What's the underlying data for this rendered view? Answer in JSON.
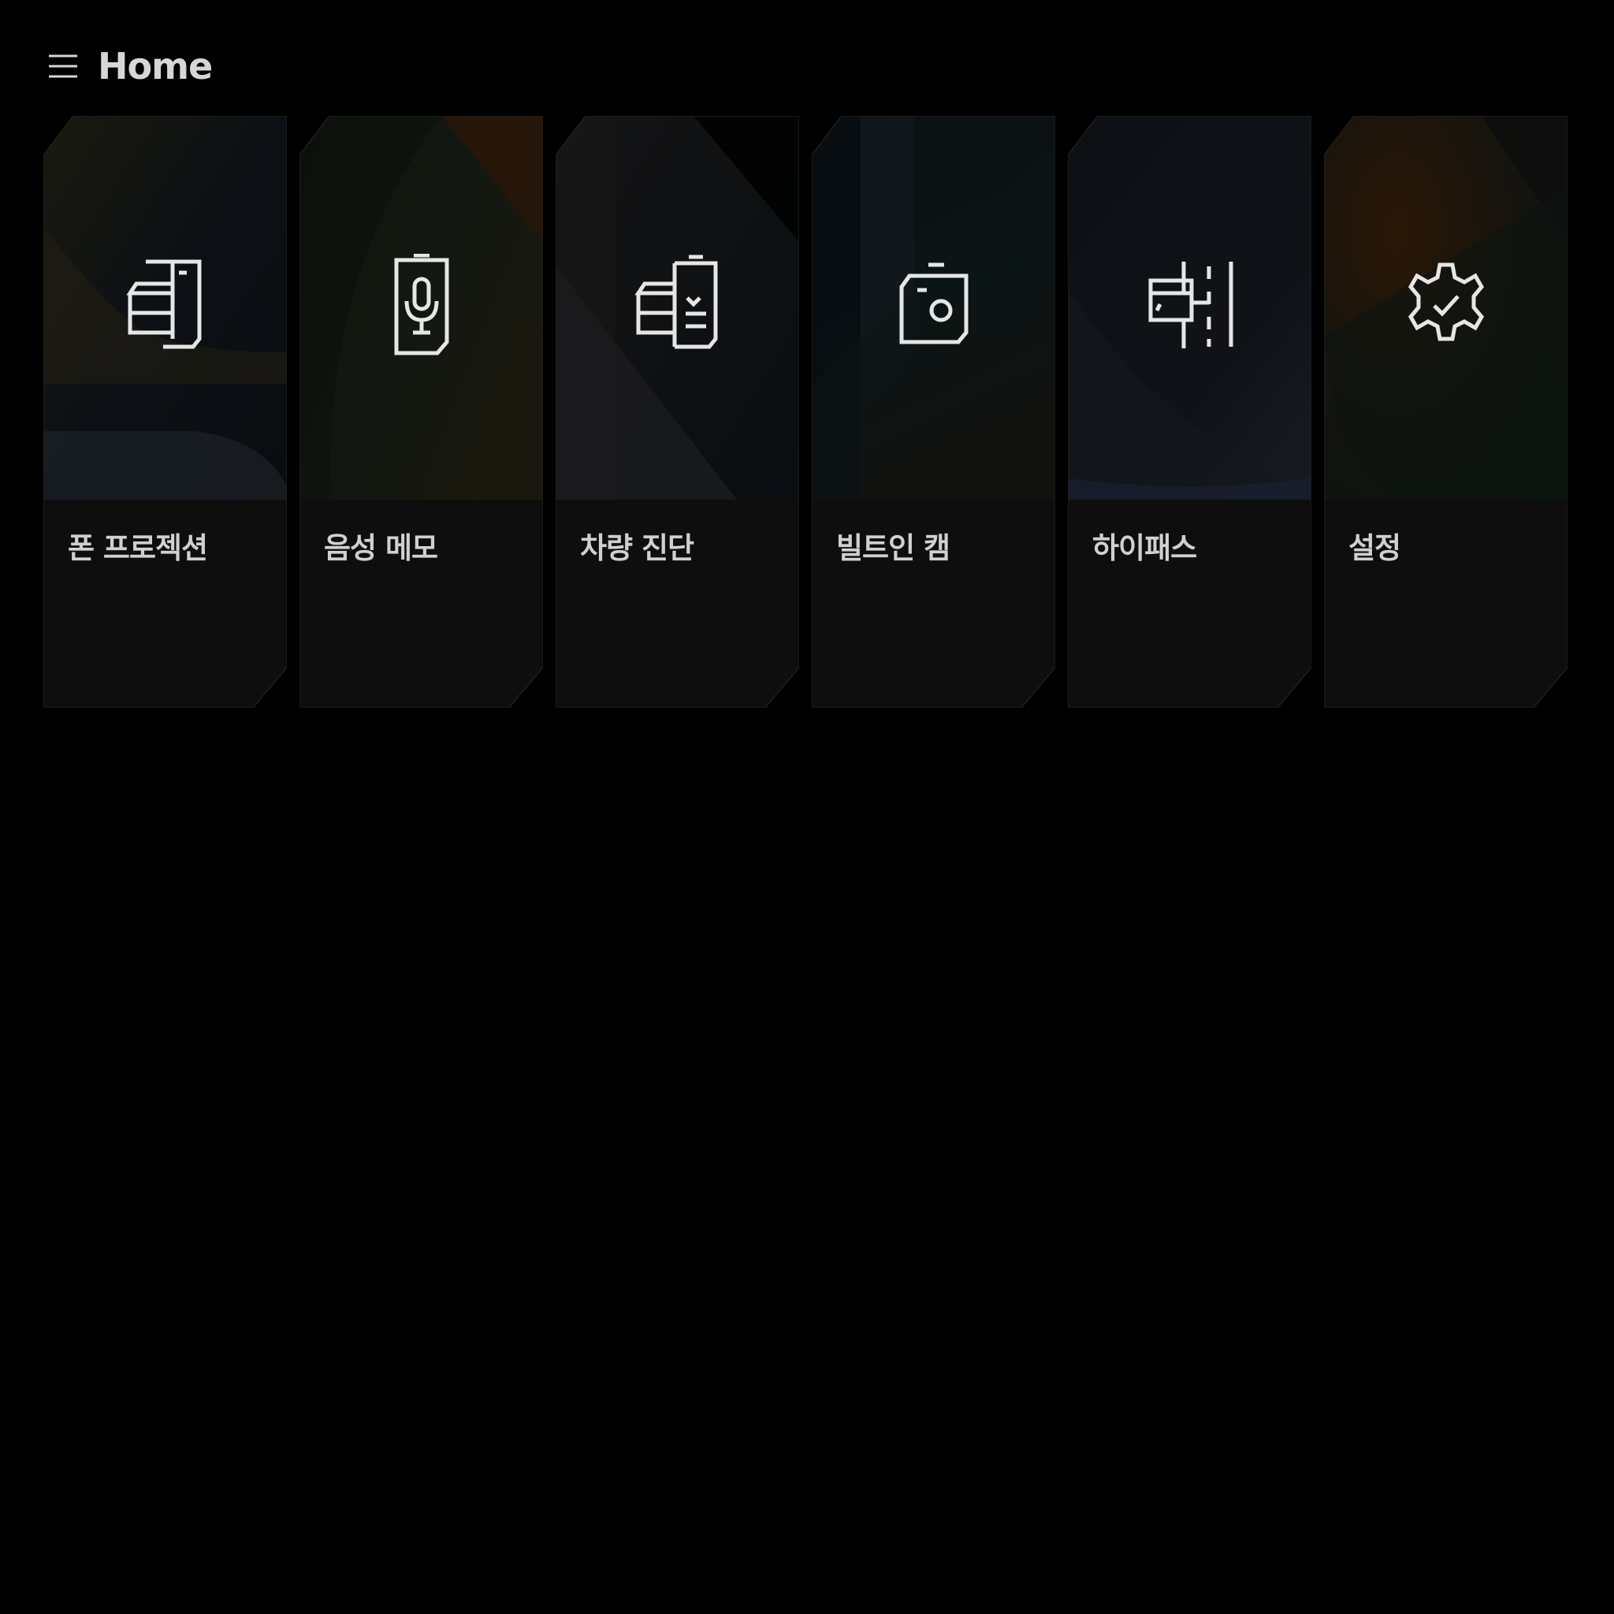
{
  "header": {
    "menu_icon": "hamburger-menu-icon",
    "title": "Home"
  },
  "cards": [
    {
      "label": "폰 프로젝션",
      "icon": "phone-projection-icon",
      "accent": "#4a3a12"
    },
    {
      "label": "음성 메모",
      "icon": "voice-memo-icon",
      "accent": "#3a1c06"
    },
    {
      "label": "차량 진단",
      "icon": "vehicle-diagnosis-icon",
      "accent": "#2a2620"
    },
    {
      "label": "빌트인 캠",
      "icon": "builtin-cam-icon",
      "accent": "#2a1606"
    },
    {
      "label": "하이패스",
      "icon": "hipass-icon",
      "accent": "#1a2038"
    },
    {
      "label": "설정",
      "icon": "settings-icon",
      "accent": "#3a1a06"
    }
  ]
}
